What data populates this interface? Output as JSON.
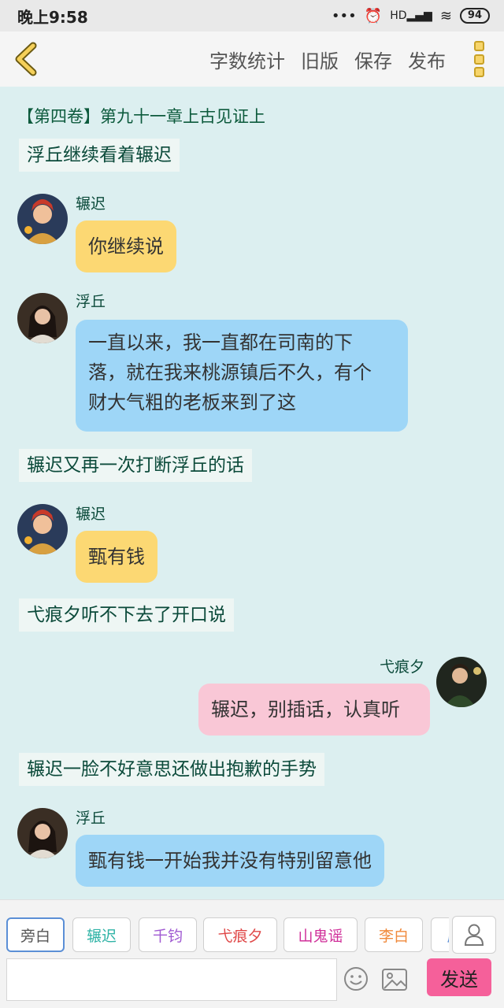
{
  "status_bar": {
    "time": "晚上9:58",
    "signal_text": "HD",
    "battery": "94"
  },
  "toolbar": {
    "items": [
      "字数统计",
      "旧版",
      "保存",
      "发布"
    ]
  },
  "chapter_title": "【第四卷】第九十一章上古见证上",
  "messages": {
    "m1": {
      "text": "浮丘继续看着辗迟"
    },
    "m2": {
      "name": "辗迟",
      "text": "你继续说"
    },
    "m3": {
      "name": "浮丘",
      "lines": [
        "一直以来，我一直都在司南的下",
        "落，就在我来桃源镇后不久，有个",
        "财大气粗的老板来到了这"
      ]
    },
    "m4": {
      "text": "辗迟又再一次打断浮丘的话"
    },
    "m5": {
      "name": "辗迟",
      "text": "甄有钱"
    },
    "m6": {
      "text": "弋痕夕听不下去了开口说"
    },
    "m7": {
      "name": "弋痕夕",
      "text": "辗迟，别插话，认真听"
    },
    "m8": {
      "text": "辗迟一脸不好意思还做出抱歉的手势"
    },
    "m9": {
      "name": "浮丘",
      "text": "甄有钱一开始我并没有特别留意他"
    }
  },
  "roles": [
    {
      "label": "旁白",
      "color": "#555555"
    },
    {
      "label": "辗迟",
      "color": "#2fb3a6"
    },
    {
      "label": "千钧",
      "color": "#a05ad2"
    },
    {
      "label": "弋痕夕",
      "color": "#e04848"
    },
    {
      "label": "山鬼谣",
      "color": "#d0309a"
    },
    {
      "label": "李白",
      "color": "#f08a3c"
    },
    {
      "label": "屈",
      "color": "#5b8fd6"
    }
  ],
  "input": {
    "placeholder": ""
  },
  "send_label": "发送"
}
